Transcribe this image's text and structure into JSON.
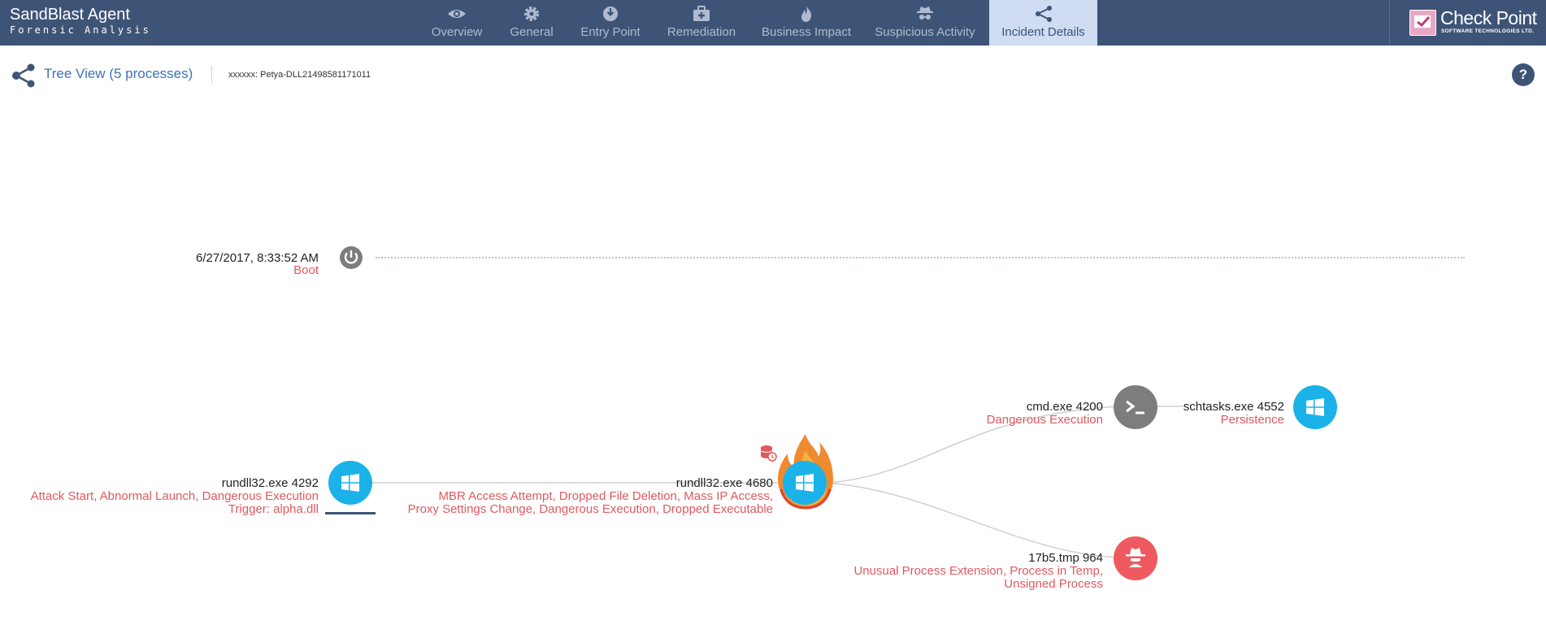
{
  "brand": {
    "title": "SandBlast Agent",
    "subtitle": "Forensic Analysis"
  },
  "tabs": [
    {
      "label": "Overview",
      "icon": "eye-icon"
    },
    {
      "label": "General",
      "icon": "gear-icon"
    },
    {
      "label": "Entry Point",
      "icon": "entry-point-icon"
    },
    {
      "label": "Remediation",
      "icon": "first-aid-kit-icon"
    },
    {
      "label": "Business Impact",
      "icon": "flame-icon"
    },
    {
      "label": "Suspicious Activity",
      "icon": "spy-icon"
    },
    {
      "label": "Incident Details",
      "icon": "share-tree-icon",
      "active": true
    }
  ],
  "logo": {
    "name": "Check Point",
    "subtitle": "SOFTWARE TECHNOLOGIES LTD."
  },
  "tree": {
    "title": "Tree View (5 processes)",
    "incident": "xxxxxx: Petya-DLL21498581171011"
  },
  "help_label": "?",
  "boot": {
    "timestamp": "6/27/2017, 8:33:52 AM",
    "label": "Boot"
  },
  "processes": {
    "p1": {
      "name": "rundll32.exe 4292",
      "tags": "Attack Start, Abnormal Launch, Dangerous Execution",
      "trigger": "Trigger: alpha.dll"
    },
    "p2": {
      "name": "rundll32.exe 4680",
      "tags_line1": "MBR Access Attempt, Dropped File Deletion, Mass IP Access,",
      "tags_line2": "Proxy Settings Change, Dangerous Execution, Dropped Executable"
    },
    "p3": {
      "name": "cmd.exe 4200",
      "tags": "Dangerous Execution"
    },
    "p4": {
      "name": "schtasks.exe 4552",
      "tags": "Persistence"
    },
    "p5": {
      "name": "17b5.tmp 964",
      "tags_line1": "Unusual Process Extension, Process in Temp,",
      "tags_line2": "Unsigned Process"
    }
  },
  "colors": {
    "header": "#3e5477",
    "active_tab": "#cfdcf2",
    "link": "#3d72b5",
    "alert": "#e0595f",
    "windows_node": "#1ab2e8",
    "terminal_node": "#7d7d7d",
    "spy_node": "#ee5a5f"
  }
}
